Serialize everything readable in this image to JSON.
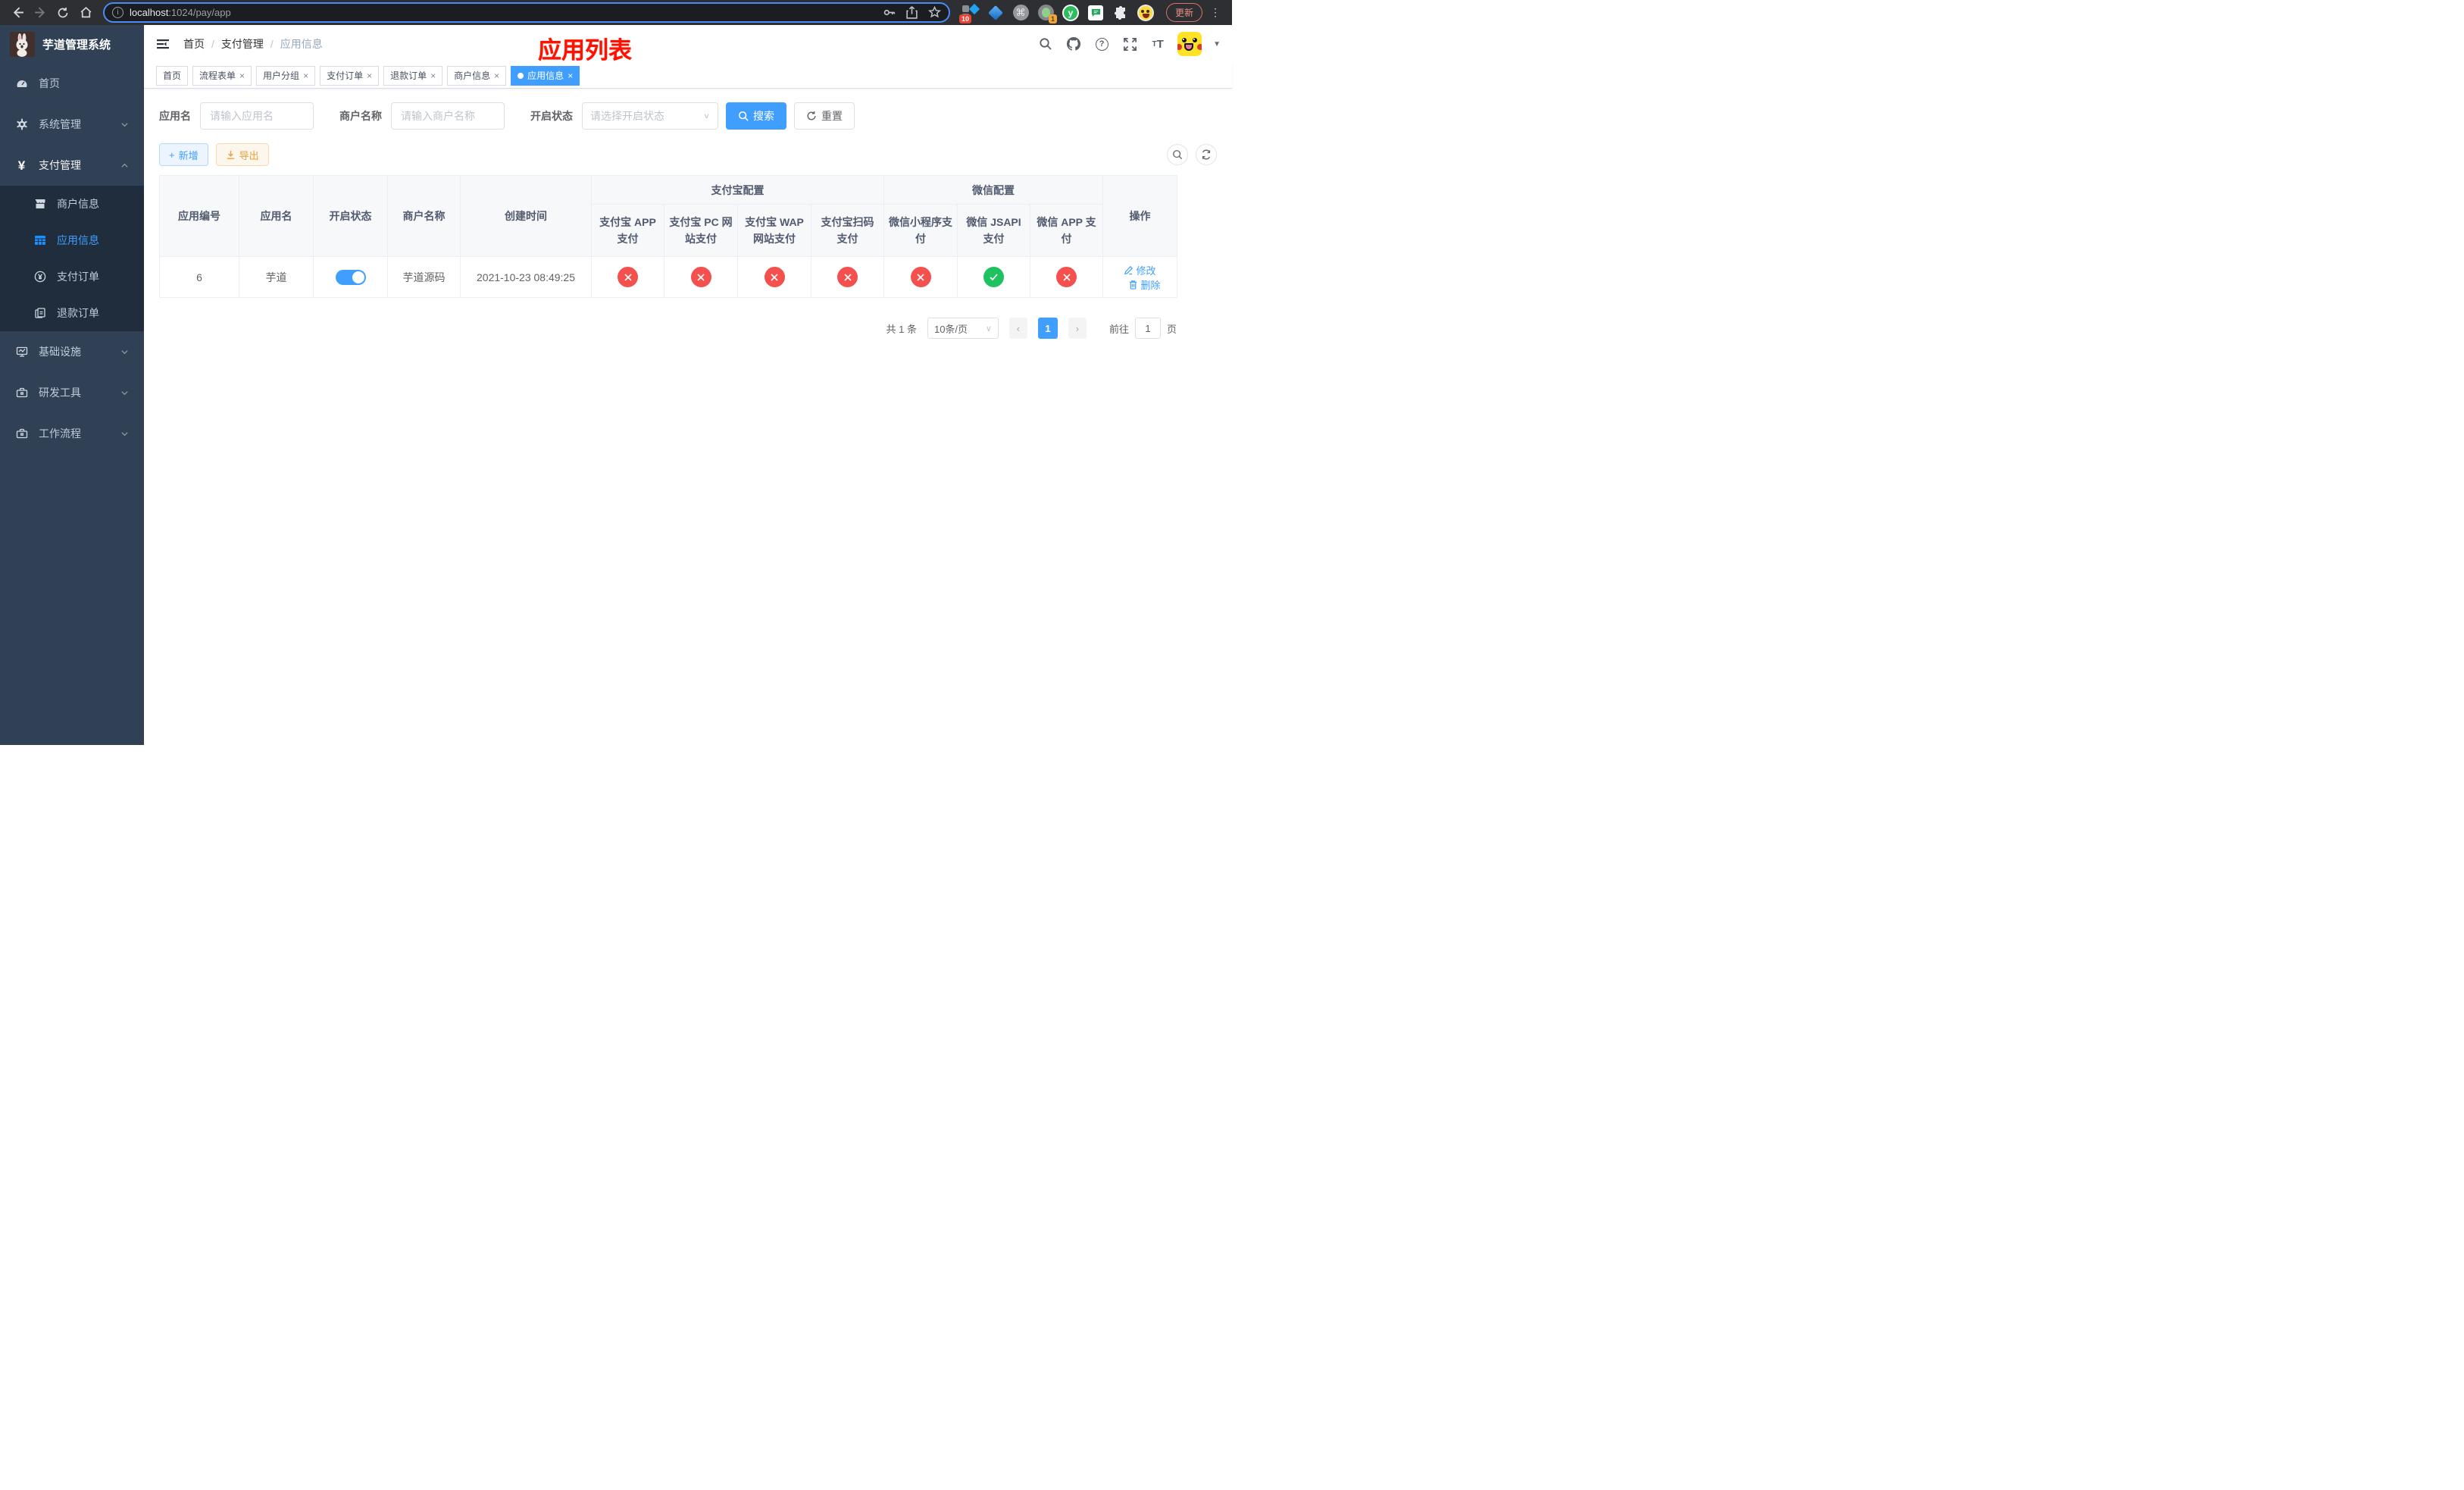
{
  "browser": {
    "url_host": "localhost",
    "url_rest": ":1024/pay/app",
    "update_label": "更新",
    "ext_badge_blue_diamond": "10",
    "ext_badge_green_dot": "1",
    "yuque_letter": "y"
  },
  "sidebar": {
    "title": "芋道管理系统",
    "items": {
      "home": "首页",
      "system": "系统管理",
      "payment": "支付管理",
      "merchant": "商户信息",
      "app_info": "应用信息",
      "pay_order": "支付订单",
      "refund_order": "退款订单",
      "infra": "基础设施",
      "dev_tools": "研发工具",
      "workflow": "工作流程"
    }
  },
  "header": {
    "breadcrumb": [
      "首页",
      "支付管理",
      "应用信息"
    ],
    "annotation": "应用列表"
  },
  "tags": [
    {
      "label": "首页",
      "closable": false,
      "active": false
    },
    {
      "label": "流程表单",
      "closable": true,
      "active": false
    },
    {
      "label": "用户分组",
      "closable": true,
      "active": false
    },
    {
      "label": "支付订单",
      "closable": true,
      "active": false
    },
    {
      "label": "退款订单",
      "closable": true,
      "active": false
    },
    {
      "label": "商户信息",
      "closable": true,
      "active": false
    },
    {
      "label": "应用信息",
      "closable": true,
      "active": true
    }
  ],
  "filters": {
    "app_name_label": "应用名",
    "app_name_placeholder": "请输入应用名",
    "merchant_label": "商户名称",
    "merchant_placeholder": "请输入商户名称",
    "status_label": "开启状态",
    "status_placeholder": "请选择开启状态",
    "search_label": "搜索",
    "reset_label": "重置"
  },
  "toolbar": {
    "add_label": "新增",
    "export_label": "导出"
  },
  "table": {
    "headers": [
      "应用编号",
      "应用名",
      "开启状态",
      "商户名称",
      "创建时间"
    ],
    "groups": [
      {
        "label": "支付宝配置",
        "cols": [
          "支付宝 APP 支付",
          "支付宝 PC 网站支付",
          "支付宝 WAP 网站支付",
          "支付宝扫码支付"
        ]
      },
      {
        "label": "微信配置",
        "cols": [
          "微信小程序支付",
          "微信 JSAPI 支付",
          "微信 APP 支付"
        ]
      }
    ],
    "action_header": "操作",
    "row": {
      "id": "6",
      "name": "芋道",
      "enabled": true,
      "merchant": "芋道源码",
      "created": "2021-10-23 08:49:25",
      "statuses": [
        "cross",
        "cross",
        "cross",
        "cross",
        "cross",
        "check",
        "cross"
      ],
      "edit_label": "修改",
      "delete_label": "删除"
    }
  },
  "pagination": {
    "total": "共 1 条",
    "page_size": "10条/页",
    "current": "1",
    "goto_prefix": "前往",
    "goto_value": "1",
    "goto_suffix": "页"
  },
  "icons": {
    "close": "×",
    "info": "i",
    "help": "?",
    "prev": "‹",
    "next": "›",
    "caret": "∨",
    "kebab": "⋮",
    "plus": "+",
    "slash": "/",
    "yen": "¥"
  },
  "colors": {
    "accent": "#409eff",
    "danger": "#f4504e",
    "success": "#1ec360",
    "warning": "#e6a23c",
    "sidebar_bg": "#304156",
    "submenu_bg": "#1f2d3d",
    "annotation": "#fe1100"
  }
}
